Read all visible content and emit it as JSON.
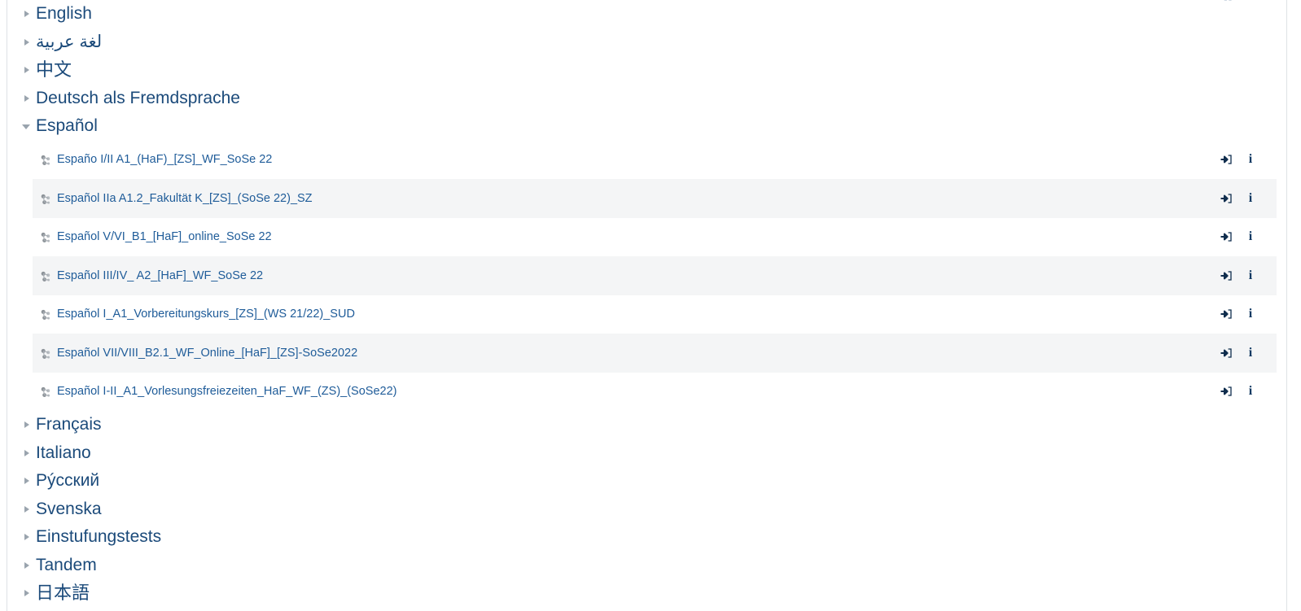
{
  "page": {
    "clipped_top_fragment": "▪▪"
  },
  "tree": {
    "categories": [
      {
        "label": "English",
        "state": "collapsed",
        "dir": "ltr",
        "script": "latin"
      },
      {
        "label": "لغة عربية",
        "state": "collapsed",
        "dir": "rtl",
        "script": "arabic"
      },
      {
        "label": "中文",
        "state": "collapsed",
        "dir": "ltr",
        "script": "cjk"
      },
      {
        "label": "Deutsch als Fremdsprache",
        "state": "collapsed",
        "dir": "ltr",
        "script": "latin"
      },
      {
        "label": "Español",
        "state": "expanded",
        "dir": "ltr",
        "script": "latin"
      }
    ],
    "categories_after": [
      {
        "label": "Français",
        "state": "collapsed",
        "dir": "ltr",
        "script": "latin"
      },
      {
        "label": "Italiano",
        "state": "collapsed",
        "dir": "ltr",
        "script": "latin"
      },
      {
        "label": "Pýсский",
        "state": "collapsed",
        "dir": "ltr",
        "script": "cyrillic"
      },
      {
        "label": "Svenska",
        "state": "collapsed",
        "dir": "ltr",
        "script": "latin"
      },
      {
        "label": "Einstufungstests",
        "state": "collapsed",
        "dir": "ltr",
        "script": "latin"
      },
      {
        "label": "Tandem",
        "state": "collapsed",
        "dir": "ltr",
        "script": "latin"
      },
      {
        "label": "日本語",
        "state": "collapsed",
        "dir": "ltr",
        "script": "cjk"
      }
    ],
    "courses": [
      {
        "name": "Españo I/II A1_(HaF)_[ZS]_WF_SoSe 22",
        "stripe": "white"
      },
      {
        "name": "Español IIa A1.2_Fakultät K_[ZS]_(SoSe 22)_SZ",
        "stripe": "grey"
      },
      {
        "name": "Español V/VI_B1_[HaF]_online_SoSe 22",
        "stripe": "white"
      },
      {
        "name": "Español III/IV_ A2_[HaF]_WF_SoSe 22",
        "stripe": "grey"
      },
      {
        "name": "Español I_A1_Vorbereitungskurs_[ZS]_(WS 21/22)_SUD",
        "stripe": "white"
      },
      {
        "name": "Español VII/VIII_B2.1_WF_Online_[HaF]_[ZS]-SoSe2022",
        "stripe": "grey"
      },
      {
        "name": "Español I-II_A1_Vorlesungsfreiezeiten_HaF_WF_(ZS)_(SoSe22)",
        "stripe": "white"
      }
    ],
    "row_actions": {
      "enroll_icon": "sign-in-icon",
      "info_icon": "info-icon",
      "course_icon": "course-globe-icon",
      "info_label": "i"
    }
  },
  "colors": {
    "category_link": "#1b4a7a",
    "course_link": "#1f5c99",
    "stripe_grey": "#f4f5f6",
    "border": "#dee2e6",
    "arrow": "#9aa4ae",
    "action_icon": "#0f2d4d"
  }
}
